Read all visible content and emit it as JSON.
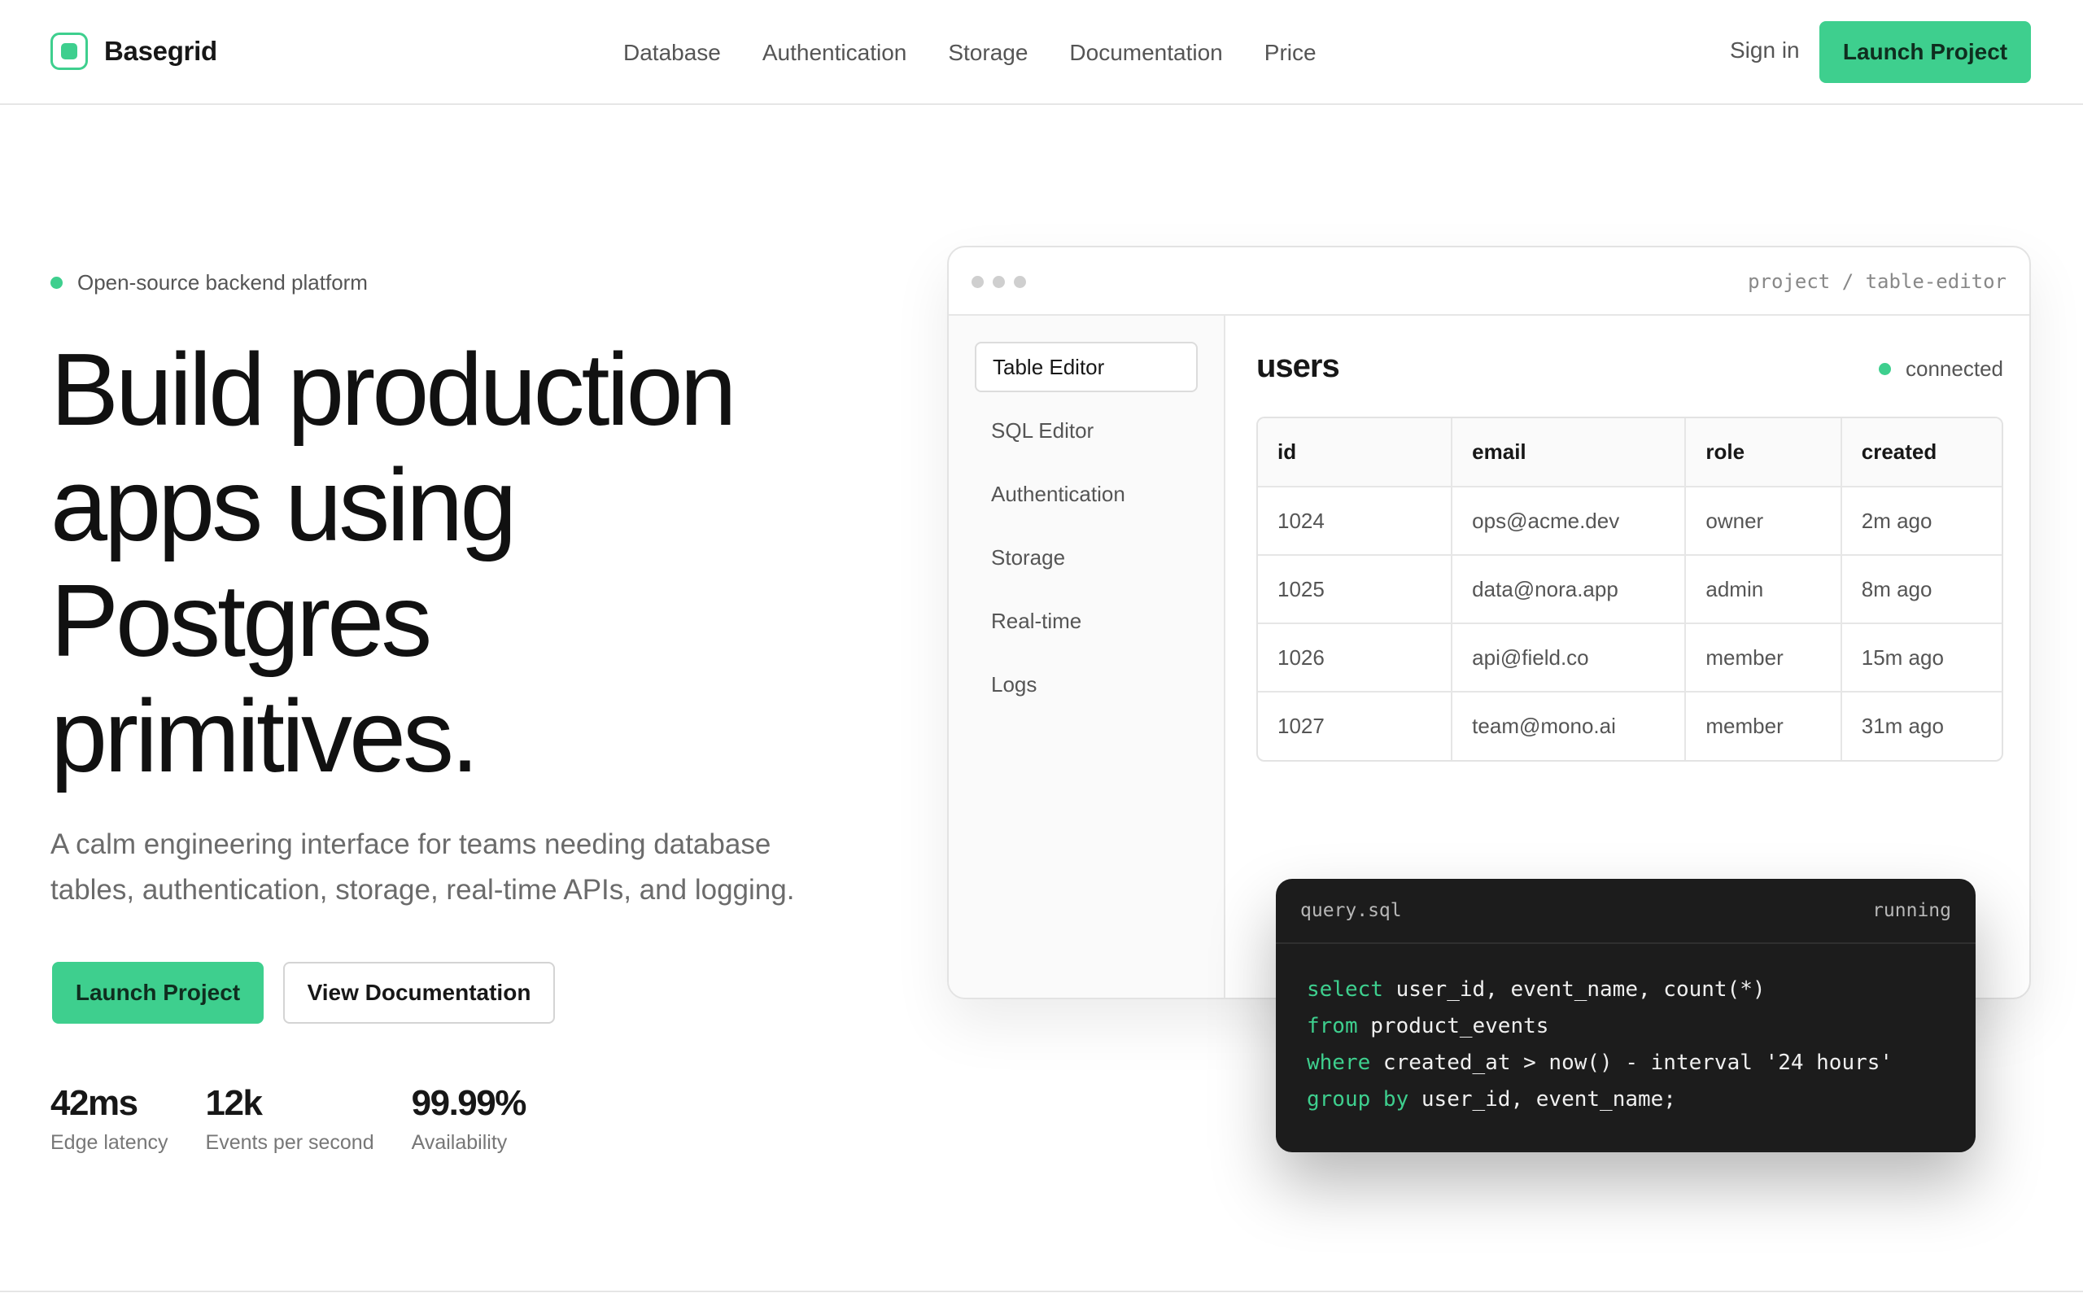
{
  "brand": {
    "name": "Basegrid",
    "accent": "#3ecf8e"
  },
  "nav": {
    "items": [
      "Database",
      "Authentication",
      "Storage",
      "Documentation",
      "Price"
    ],
    "sign_in": "Sign in",
    "launch": "Launch Project"
  },
  "hero": {
    "eyebrow": "Open-source backend platform",
    "headline": [
      "Build production",
      "apps using",
      "Postgres",
      "primitives."
    ],
    "subtitle": [
      "A calm engineering interface for teams needing database",
      "tables, authentication, storage, real-time APIs, and logging."
    ],
    "primary_cta": "Launch Project",
    "secondary_cta": "View Documentation",
    "stats": [
      {
        "value": "42ms",
        "label": "Edge latency"
      },
      {
        "value": "12k",
        "label": "Events per second"
      },
      {
        "value": "99.99%",
        "label": "Availability"
      }
    ]
  },
  "window": {
    "path": "project / table-editor",
    "sidebar": [
      "Table Editor",
      "SQL Editor",
      "Authentication",
      "Storage",
      "Real-time",
      "Logs"
    ],
    "active_item": "Table Editor",
    "table_name": "users",
    "status": "connected",
    "columns": [
      "id",
      "email",
      "role",
      "created"
    ],
    "rows": [
      [
        "1024",
        "ops@acme.dev",
        "owner",
        "2m ago"
      ],
      [
        "1025",
        "data@nora.app",
        "admin",
        "8m ago"
      ],
      [
        "1026",
        "api@field.co",
        "member",
        "15m ago"
      ],
      [
        "1027",
        "team@mono.ai",
        "member",
        "31m ago"
      ]
    ]
  },
  "query": {
    "file": "query.sql",
    "status": "running",
    "lines": [
      {
        "kw": "select",
        "rest": " user_id, event_name, count(*)"
      },
      {
        "kw": "from",
        "rest": " product_events"
      },
      {
        "kw": "where",
        "rest": " created_at > now() - interval '24 hours'"
      },
      {
        "kw": "group by",
        "rest": " user_id, event_name;"
      }
    ]
  }
}
